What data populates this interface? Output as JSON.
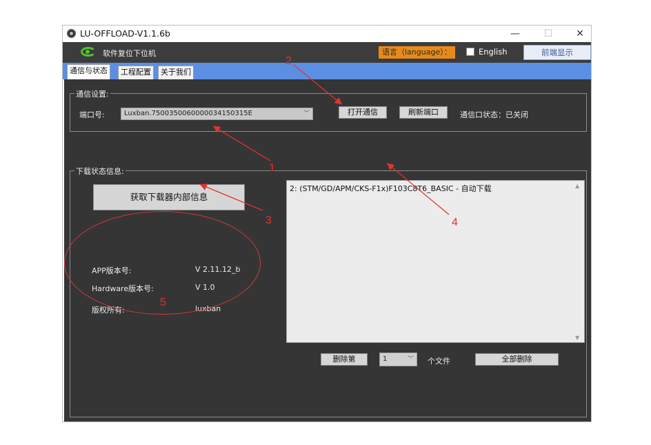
{
  "window": {
    "title": "LU-OFFLOAD-V1.1.6b",
    "minimize_glyph": "—",
    "maximize_glyph": "☐",
    "close_glyph": "✕"
  },
  "header": {
    "app_name": "软件复位下位机",
    "language_label": "语言（language）：",
    "language_option": "English",
    "language_checked": false,
    "front_button": "前端显示"
  },
  "tabs": [
    {
      "label": "通信与状态",
      "active": true
    },
    {
      "label": "工程配置",
      "active": false
    },
    {
      "label": "关于我们",
      "active": false
    }
  ],
  "comm": {
    "group_title": "通信设置:",
    "port_label": "端口号:",
    "port_value": "Luxban.7500350060000034150315E",
    "open_button": "打开通信",
    "refresh_button": "刷新端口",
    "status_text": "通信口状态：已关闭"
  },
  "download": {
    "group_title": "下载状态信息:",
    "get_info_button": "获取下载器内部信息",
    "app_version_label": "APP版本号:",
    "app_version_value": "V 2.11.12_b",
    "hw_version_label": "Hardware版本号:",
    "hw_version_value": "V 1.0",
    "copyright_label": "版权所有:",
    "copyright_value": "luxban",
    "log_lines": [
      "2: (STM/GD/APM/CKS-F1x)F103C8T6_BASIC - 自动下载"
    ],
    "delete_button": "删除第",
    "file_index": "1",
    "file_unit": "个文件",
    "delete_all_button": "全部删除"
  },
  "annotations": {
    "n1": "1",
    "n2": "2",
    "n3": "3",
    "n4": "4",
    "n5": "5"
  },
  "colors": {
    "annotation": "#e23232",
    "tab_strip": "#5b8fe4",
    "panel": "#353535",
    "lang_bg": "#e88a1a"
  }
}
